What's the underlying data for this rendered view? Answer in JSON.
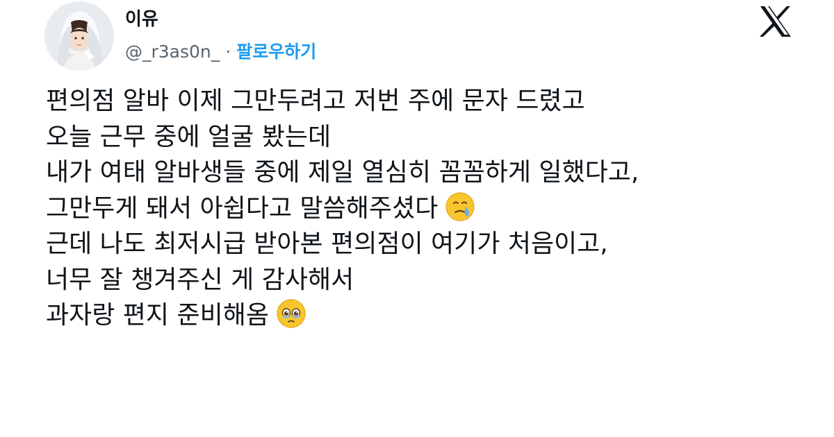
{
  "user": {
    "display_name": "이유",
    "handle": "@_r3as0n_",
    "separator": "·",
    "follow_label": "팔로우하기"
  },
  "platform": {
    "logo_icon": "x-logo-icon"
  },
  "tweet": {
    "lines": [
      "편의점 알바 이제 그만두려고 저번 주에 문자 드렸고",
      "오늘 근무 중에 얼굴 봤는데",
      "내가 여태 알바생들 중에 제일 열심히 꼼꼼하게 일했다고,",
      "그만두게 돼서 아쉽다고 말씀해주셨다",
      "근데 나도 최저시급 받아본 편의점이 여기가 처음이고,",
      "너무 잘 챙겨주신 게 감사해서",
      "과자랑 편지 준비해옴"
    ],
    "emojis": {
      "line4": "face-holding-back-tears-icon",
      "line7": "face-holding-back-tears-icon"
    }
  },
  "colors": {
    "text": "#0f1419",
    "secondary": "#536471",
    "link": "#1d9bf0",
    "emoji": "#f9c52f"
  }
}
